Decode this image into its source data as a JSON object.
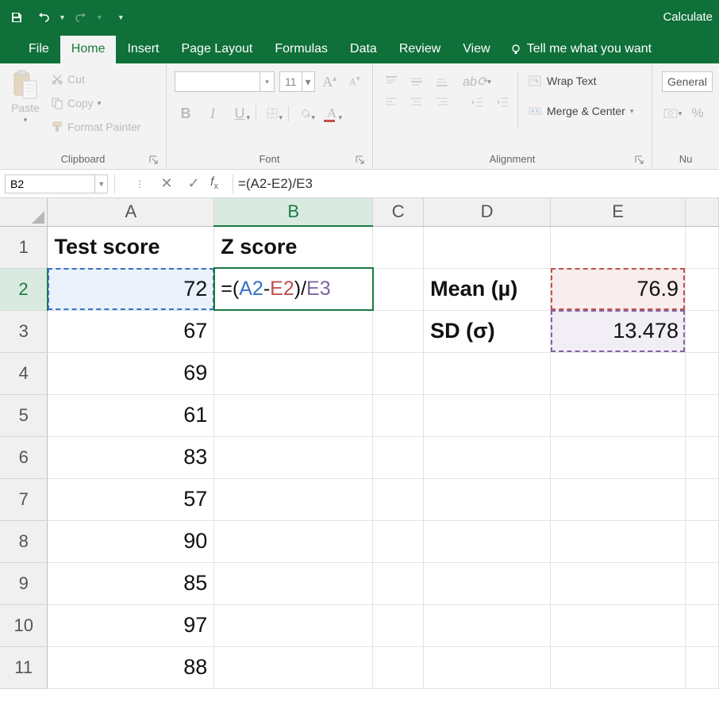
{
  "titlebar": {
    "right_text": "Calculate"
  },
  "tabs": {
    "file": "File",
    "home": "Home",
    "insert": "Insert",
    "page_layout": "Page Layout",
    "formulas": "Formulas",
    "data": "Data",
    "review": "Review",
    "view": "View",
    "tell_me": "Tell me what you want"
  },
  "ribbon": {
    "clipboard": {
      "label": "Clipboard",
      "paste": "Paste",
      "cut": "Cut",
      "copy": "Copy",
      "fp": "Format Painter"
    },
    "font": {
      "label": "Font",
      "size": "11"
    },
    "align": {
      "label": "Alignment",
      "wrap": "Wrap Text",
      "merge": "Merge & Center"
    },
    "number": {
      "label": "Nu",
      "format": "General"
    }
  },
  "namebox": "B2",
  "formula": "=(A2-E2)/E3",
  "columns": [
    "A",
    "B",
    "C",
    "D",
    "E",
    ""
  ],
  "rows": [
    "1",
    "2",
    "3",
    "4",
    "5",
    "6",
    "7",
    "8",
    "9",
    "10",
    "11"
  ],
  "cells": {
    "A1": "Test score",
    "B1": "Z score",
    "A2": "72",
    "A3": "67",
    "A4": "69",
    "A5": "61",
    "A6": "83",
    "A7": "57",
    "A8": "90",
    "A9": "85",
    "A10": "97",
    "A11": "88",
    "D2": "Mean (µ)",
    "E2": "76.9",
    "D3": "SD (σ)",
    "E3": "13.478"
  },
  "b2_formula": {
    "before": "=(",
    "a": "A2",
    "mid1": "-",
    "e1": "E2",
    "mid2": ")/",
    "e2": "E3"
  },
  "chart_data": {
    "type": "table",
    "headers": [
      "Test score"
    ],
    "values": [
      72,
      67,
      69,
      61,
      83,
      57,
      90,
      85,
      97,
      88
    ],
    "stats": {
      "mean": 76.9,
      "sd": 13.478
    },
    "active_formula": "=(A2-E2)/E3"
  }
}
